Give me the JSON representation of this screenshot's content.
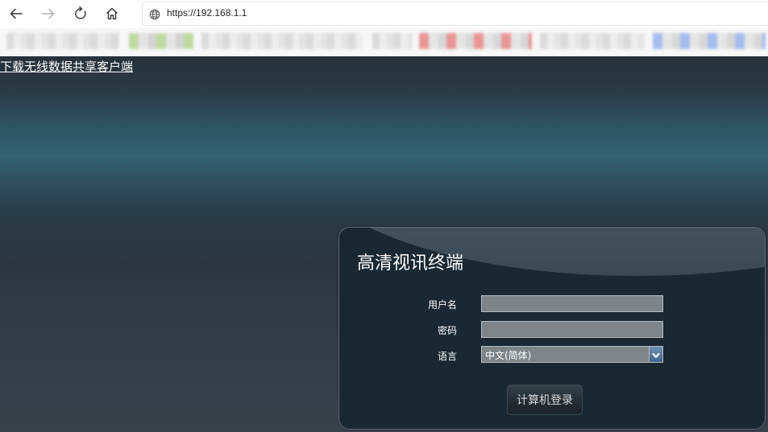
{
  "browser": {
    "url": "https://192.168.1.1",
    "nav_icons": [
      "back-arrow-icon",
      "forward-arrow-icon",
      "refresh-icon",
      "home-icon",
      "globe-icon"
    ]
  },
  "page": {
    "download_link": "下载无线数据共享客户端"
  },
  "login": {
    "title": "高清视讯终端",
    "username_label": "用户名",
    "username_value": "",
    "password_label": "密码",
    "password_value": "",
    "language_label": "语言",
    "language_selected": "中文(简体)",
    "submit_label": "计算机登录"
  },
  "colors": {
    "panel_bg": "#192831",
    "field_bg": "#7d8588",
    "page_accent": "#346272"
  }
}
